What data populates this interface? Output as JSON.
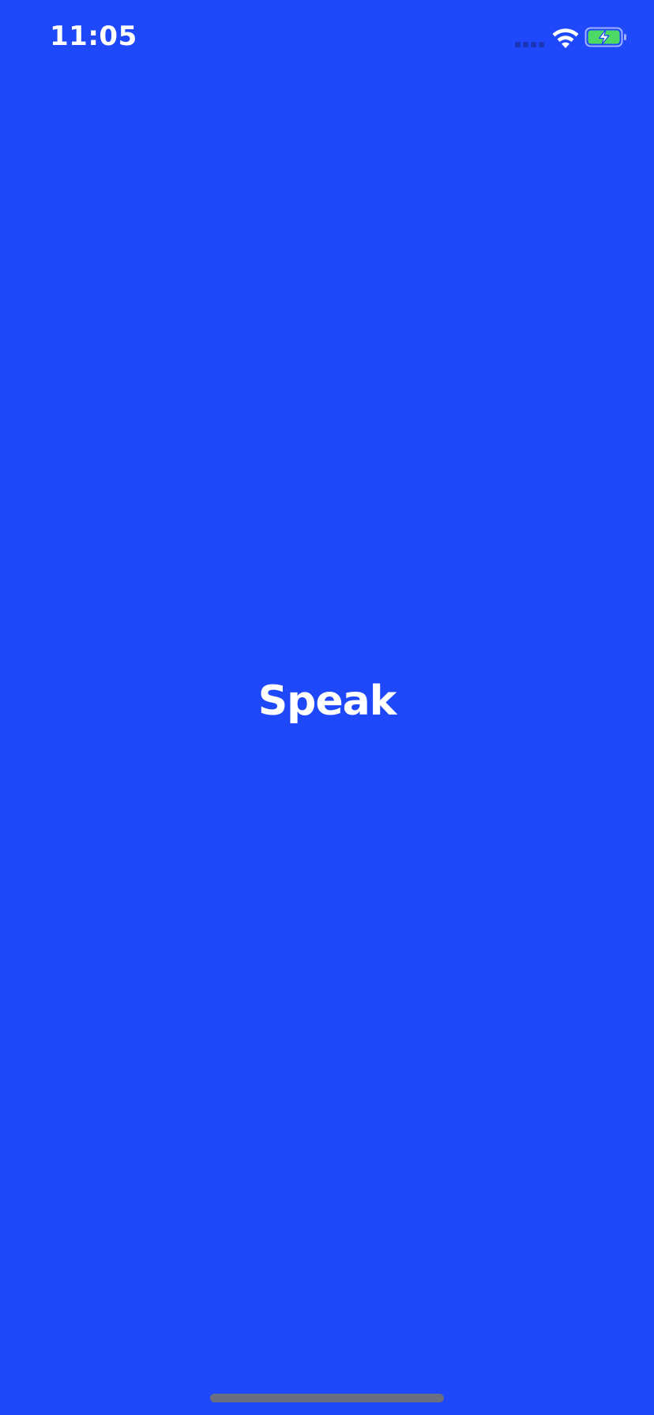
{
  "status_bar": {
    "time": "11:05",
    "wifi_icon": "wifi-icon",
    "battery_icon": "battery-charging-icon",
    "signal_icon": "cellular-signal-icon"
  },
  "splash": {
    "title": "Speak"
  },
  "colors": {
    "background": "#1f48fa",
    "text": "#ffffff",
    "battery_fill": "#4cd964",
    "home_indicator": "#6b6f80"
  }
}
